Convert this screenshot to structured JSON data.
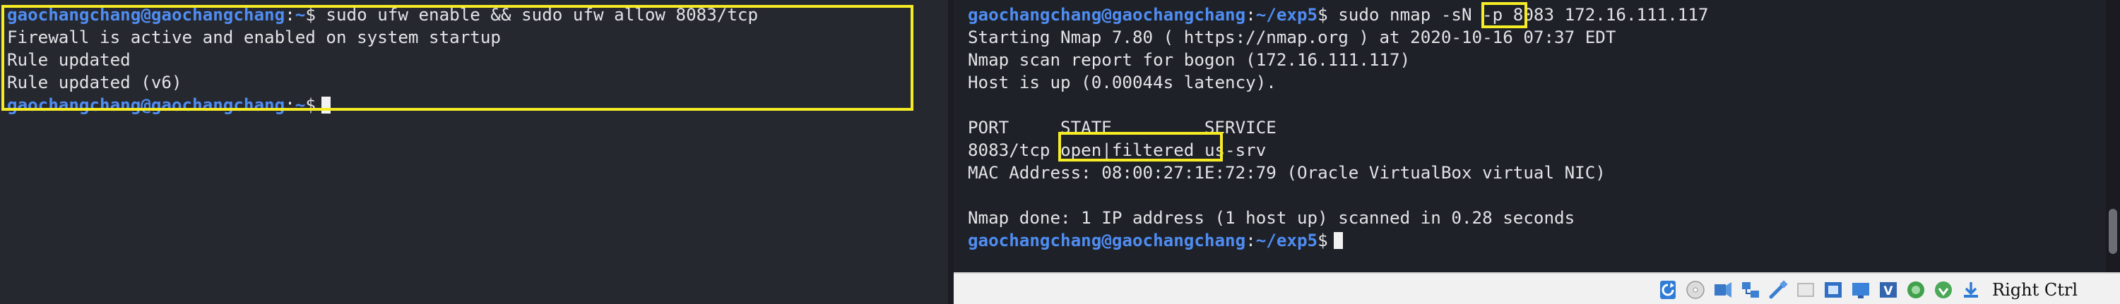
{
  "left_terminal": {
    "prompt": {
      "user": "gaochangchang@gaochangchang",
      "sep": ":",
      "path": "~",
      "symbol": "$"
    },
    "lines": [
      {
        "command": " sudo ufw enable && sudo ufw allow 8083/tcp"
      },
      {
        "text": "Firewall is active and enabled on system startup"
      },
      {
        "text": "Rule updated"
      },
      {
        "text": "Rule updated (v6)"
      }
    ]
  },
  "right_terminal": {
    "prompt": {
      "user": "gaochangchang@gaochangchang",
      "sep": ":",
      "path": "~/exp5",
      "symbol": "$"
    },
    "command_prefix": " sudo nmap ",
    "command_flag": "-sN",
    "command_suffix": " -p 8083 172.16.111.117",
    "output": [
      "Starting Nmap 7.80 ( https://nmap.org ) at 2020-10-16 07:37 EDT",
      "Nmap scan report for bogon (172.16.111.117)",
      "Host is up (0.00044s latency).",
      "",
      "PORT     STATE         SERVICE"
    ],
    "port_row": {
      "port": "8083/tcp",
      "state": "open|filtered",
      "service": "us-srv"
    },
    "after_port": [
      "MAC Address: 08:00:27:1E:72:79 (Oracle VirtualBox virtual NIC)",
      "",
      "Nmap done: 1 IP address (1 host up) scanned in 0.28 seconds"
    ]
  },
  "statusbar": {
    "host_key_label": "Right Ctrl",
    "icons": [
      "refresh-icon",
      "optical-drive-icon",
      "audio-icon",
      "network-icon",
      "usb-icon",
      "shared-folder-icon",
      "display-icon",
      "screen-icon",
      "recording-icon",
      "cpu-icon",
      "mouse-integration-icon",
      "keyboard-capture-icon"
    ]
  },
  "colors": {
    "prompt": "#4f8df2",
    "text": "#e2e3e6",
    "highlight_box": "#f6ec25",
    "terminal_bg": "#262830"
  }
}
